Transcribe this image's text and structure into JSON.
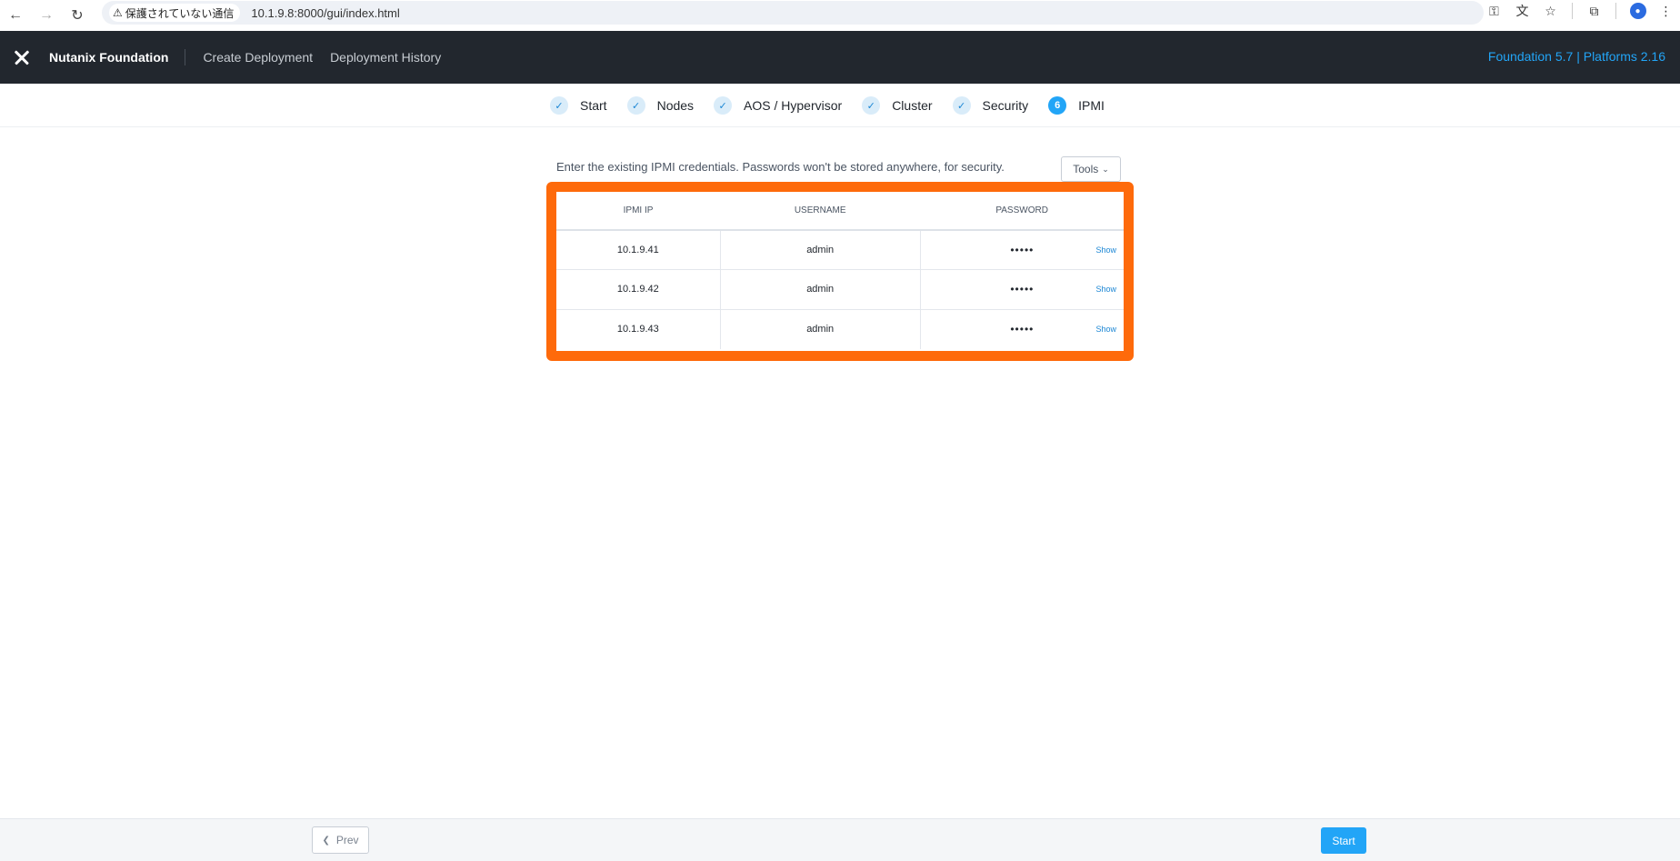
{
  "browser": {
    "security_label": "保護されていない通信",
    "url": "10.1.9.8:8000/gui/index.html"
  },
  "header": {
    "brand": "Nutanix Foundation",
    "nav": [
      "Create Deployment",
      "Deployment History"
    ],
    "version": "Foundation 5.7 | Platforms 2.16"
  },
  "stepper": {
    "steps": [
      {
        "marker": "✓",
        "label": "Start"
      },
      {
        "marker": "✓",
        "label": "Nodes"
      },
      {
        "marker": "✓",
        "label": "AOS / Hypervisor"
      },
      {
        "marker": "✓",
        "label": "Cluster"
      },
      {
        "marker": "✓",
        "label": "Security"
      },
      {
        "marker": "6",
        "label": "IPMI"
      }
    ],
    "active_index": 5
  },
  "main": {
    "intro": "Enter the existing IPMI credentials. Passwords won't be stored anywhere, for security.",
    "tools_label": "Tools",
    "table": {
      "headers": [
        "IPMI IP",
        "USERNAME",
        "PASSWORD"
      ],
      "rows": [
        {
          "ip": "10.1.9.41",
          "username": "admin",
          "password": "•••••",
          "show": "Show"
        },
        {
          "ip": "10.1.9.42",
          "username": "admin",
          "password": "•••••",
          "show": "Show"
        },
        {
          "ip": "10.1.9.43",
          "username": "admin",
          "password": "•••••",
          "show": "Show"
        }
      ]
    },
    "highlight_color": "#fe6a0b"
  },
  "footer": {
    "prev_label": "Prev",
    "start_label": "Start"
  },
  "colors": {
    "accent": "#22a5f7",
    "header_bg": "#22272e"
  }
}
